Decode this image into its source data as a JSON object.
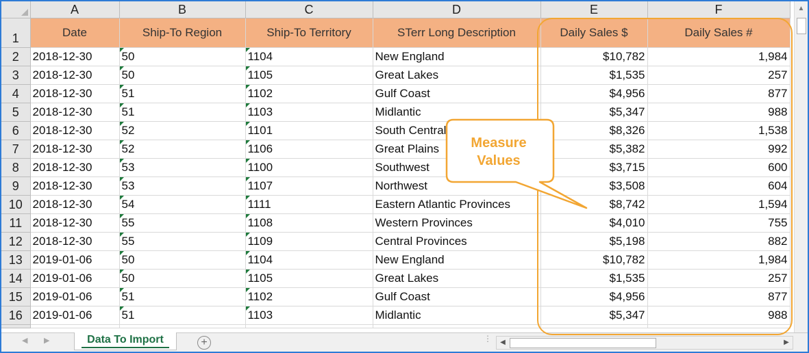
{
  "columns": [
    "A",
    "B",
    "C",
    "D",
    "E",
    "F"
  ],
  "header_row_number": "1",
  "headers": [
    "Date",
    "Ship-To Region",
    "Ship-To Territory",
    "STerr Long Description",
    "Daily Sales $",
    "Daily Sales #"
  ],
  "rows": [
    {
      "n": "2",
      "date": "2018-12-30",
      "region": "50",
      "territory": "1104",
      "desc": "New England",
      "sales": "$10,782",
      "count": "1,984"
    },
    {
      "n": "3",
      "date": "2018-12-30",
      "region": "50",
      "territory": "1105",
      "desc": "Great Lakes",
      "sales": "$1,535",
      "count": "257"
    },
    {
      "n": "4",
      "date": "2018-12-30",
      "region": "51",
      "territory": "1102",
      "desc": "Gulf Coast",
      "sales": "$4,956",
      "count": "877"
    },
    {
      "n": "5",
      "date": "2018-12-30",
      "region": "51",
      "territory": "1103",
      "desc": "Midlantic",
      "sales": "$5,347",
      "count": "988"
    },
    {
      "n": "6",
      "date": "2018-12-30",
      "region": "52",
      "territory": "1101",
      "desc": "South Central",
      "sales": "$8,326",
      "count": "1,538"
    },
    {
      "n": "7",
      "date": "2018-12-30",
      "region": "52",
      "territory": "1106",
      "desc": "Great Plains",
      "sales": "$5,382",
      "count": "992"
    },
    {
      "n": "8",
      "date": "2018-12-30",
      "region": "53",
      "territory": "1100",
      "desc": "Southwest",
      "sales": "$3,715",
      "count": "600"
    },
    {
      "n": "9",
      "date": "2018-12-30",
      "region": "53",
      "territory": "1107",
      "desc": "Northwest",
      "sales": "$3,508",
      "count": "604"
    },
    {
      "n": "10",
      "date": "2018-12-30",
      "region": "54",
      "territory": "1111",
      "desc": "Eastern Atlantic Provinces",
      "sales": "$8,742",
      "count": "1,594"
    },
    {
      "n": "11",
      "date": "2018-12-30",
      "region": "55",
      "territory": "1108",
      "desc": "Western Provinces",
      "sales": "$4,010",
      "count": "755"
    },
    {
      "n": "12",
      "date": "2018-12-30",
      "region": "55",
      "territory": "1109",
      "desc": "Central Provinces",
      "sales": "$5,198",
      "count": "882"
    },
    {
      "n": "13",
      "date": "2019-01-06",
      "region": "50",
      "territory": "1104",
      "desc": "New England",
      "sales": "$10,782",
      "count": "1,984"
    },
    {
      "n": "14",
      "date": "2019-01-06",
      "region": "50",
      "territory": "1105",
      "desc": "Great Lakes",
      "sales": "$1,535",
      "count": "257"
    },
    {
      "n": "15",
      "date": "2019-01-06",
      "region": "51",
      "territory": "1102",
      "desc": "Gulf Coast",
      "sales": "$4,956",
      "count": "877"
    },
    {
      "n": "16",
      "date": "2019-01-06",
      "region": "51",
      "territory": "1103",
      "desc": "Midlantic",
      "sales": "$5,347",
      "count": "988"
    }
  ],
  "callout": {
    "line1": "Measure",
    "line2": "Values"
  },
  "sheet_tab": {
    "label": "Data To Import",
    "color": "#1e7145"
  },
  "colors": {
    "header_fill": "#f4b183",
    "highlight": "#f2a633",
    "window_border": "#2e7bd6"
  },
  "icons": {
    "add_sheet": "plus-circle-icon",
    "scroll_left": "chevron-left-icon",
    "scroll_right": "chevron-right-icon",
    "scroll_up": "chevron-up-icon",
    "scroll_down": "chevron-down-icon"
  }
}
